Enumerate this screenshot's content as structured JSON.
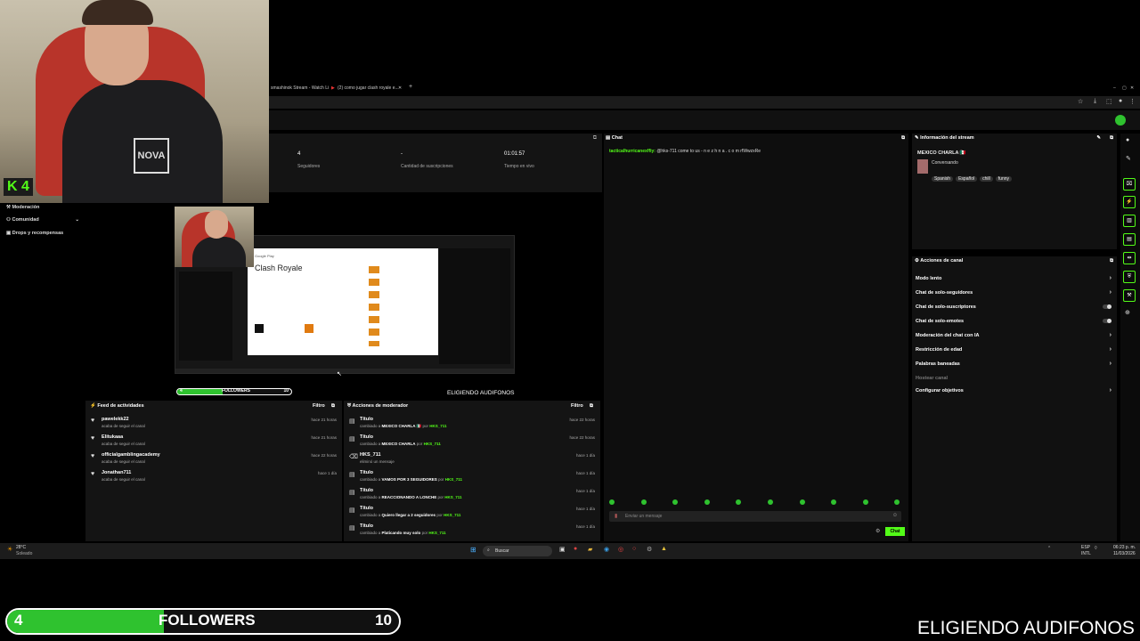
{
  "browser": {
    "tabs": [
      "smashinok Stream - Watch Li",
      "(2) como jugar clash royale e..."
    ],
    "new_tab_label": "+"
  },
  "webcam": {
    "badge": "4",
    "shirt_logo": "NOVA"
  },
  "stats": [
    {
      "value": "4",
      "label": "Seguidores"
    },
    {
      "value": "-",
      "label": "Cantidad de suscripciones"
    },
    {
      "value": "01:01:57",
      "label": "Tiempo en vivo"
    }
  ],
  "left_nav": {
    "items": [
      "Moderación",
      "Comunidad",
      "Drops y recompensas"
    ]
  },
  "preview": {
    "page_title": "Clash Royale",
    "store_label": "Google Play",
    "follower_count": "4",
    "follower_goal": "10",
    "follower_label": "FOLLOWERS",
    "caption": "ELIGIENDO AUDIFONOS"
  },
  "activity_feed": {
    "title": "Feed de actividades",
    "filter": "Filtro",
    "items": [
      {
        "name": "pawelekk22",
        "sub": "acaba de seguir el canal",
        "time": "hace 21 horas"
      },
      {
        "name": "Elitukaaa",
        "sub": "acaba de seguir el canal",
        "time": "hace 21 horas"
      },
      {
        "name": "officialgamblingacademy",
        "sub": "acaba de seguir el canal",
        "time": "hace 22 horas"
      },
      {
        "name": "Jonathan711",
        "sub": "acaba de seguir el canal",
        "time": "hace 1 día"
      }
    ]
  },
  "mod_actions": {
    "title": "Acciones de moderador",
    "filter": "Filtro",
    "items": [
      {
        "title": "Título",
        "pre": "cambiado a",
        "value": "MEXICO CHARLA 🇲🇽",
        "by": "por",
        "user": "HKS_711",
        "time": "hace 22 horas"
      },
      {
        "title": "Título",
        "pre": "cambiado a",
        "value": "MEXICO CHARLA",
        "by": "por",
        "user": "HKS_711",
        "time": "hace 22 horas"
      },
      {
        "title": "HKS_711",
        "pre": "eliminó un mensaje",
        "value": "",
        "by": "",
        "user": "",
        "time": "hace 1 día"
      },
      {
        "title": "Título",
        "pre": "cambiado a",
        "value": "VAMOS POR 3 SEGUIDORES",
        "by": "por",
        "user": "HKS_711",
        "time": "hace 1 día"
      },
      {
        "title": "Título",
        "pre": "cambiado a",
        "value": "REACCIONANDO A LONCHE",
        "by": "por",
        "user": "HKS_711",
        "time": "hace 1 día"
      },
      {
        "title": "Título",
        "pre": "cambiado a",
        "value": "Quiero llegar a 2 seguidores",
        "by": "por",
        "user": "HKS_711",
        "time": "hace 1 día"
      },
      {
        "title": "Título",
        "pre": "cambiado a",
        "value": "Platicando muy solo",
        "by": "por",
        "user": "HKS_711",
        "time": "hace 1 día"
      }
    ]
  },
  "chat": {
    "title": "Chat",
    "messages": [
      {
        "user": "tacticalhurricanexffiy:",
        "text": "@hks-711 come to us - n e z h n a . c o m rfWwzxRe"
      }
    ],
    "input_placeholder": "Enviar un mensaje",
    "send_label": "Chat"
  },
  "stream_info": {
    "title": "Información del stream",
    "stream_title": "MEXICO CHARLA 🇲🇽",
    "category": "Conversando",
    "tags": [
      "Spanish",
      "Español",
      "chill",
      "funny"
    ]
  },
  "channel_actions": {
    "title": "Acciones de canal",
    "items": [
      {
        "label": "Modo lento",
        "control": "arrow"
      },
      {
        "label": "Chat de solo-seguidores",
        "control": "arrow"
      },
      {
        "label": "Chat de solo-suscriptores",
        "control": "toggle"
      },
      {
        "label": "Chat de solo-emotes",
        "control": "toggle"
      },
      {
        "label": "Moderación del chat con IA",
        "control": "arrow"
      },
      {
        "label": "Restricción de edad",
        "control": "arrow"
      },
      {
        "label": "Palabras baneadas",
        "control": "arrow"
      },
      {
        "label": "Hostear canal",
        "control": "none"
      },
      {
        "label": "Configurar objetivos",
        "control": "arrow"
      }
    ]
  },
  "taskbar": {
    "weather_temp": "28°C",
    "weather_text": "Soleado",
    "search": "Buscar",
    "lang": "ESP",
    "region": "INTL",
    "time": "06:23 p. m.",
    "date": "11/03/2026"
  },
  "overlay": {
    "follower_count": "4",
    "follower_label": "FOLLOWERS",
    "follower_goal": "10",
    "follower_progress": 0.4,
    "caption": "ELIGIENDO AUDIFONOS"
  },
  "colors": {
    "accent": "#53fc18",
    "progress": "#2fc22f"
  }
}
